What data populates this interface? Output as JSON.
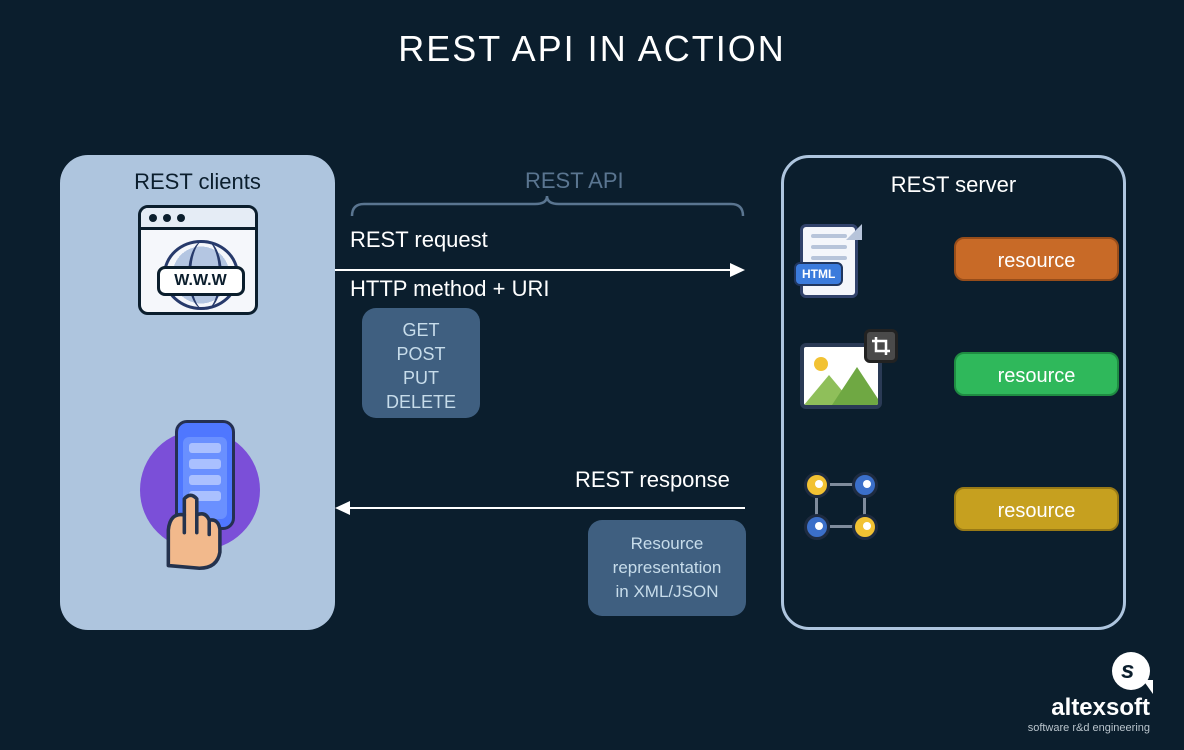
{
  "title": "REST API IN ACTION",
  "clients": {
    "heading": "REST clients",
    "www_label": "W.W.W"
  },
  "api": {
    "label": "REST API",
    "request_label": "REST request",
    "http_label": "HTTP method + URI",
    "methods": {
      "m1": "GET",
      "m2": "POST",
      "m3": "PUT",
      "m4": "DELETE"
    },
    "response_label": "REST response",
    "representation_line1": "Resource",
    "representation_line2": "representation",
    "representation_line3": "in XML/JSON"
  },
  "server": {
    "heading": "REST server",
    "html_badge": "HTML",
    "resource_label": "resource"
  },
  "logo": {
    "name": "altexsoft",
    "tagline": "software r&d engineering"
  }
}
